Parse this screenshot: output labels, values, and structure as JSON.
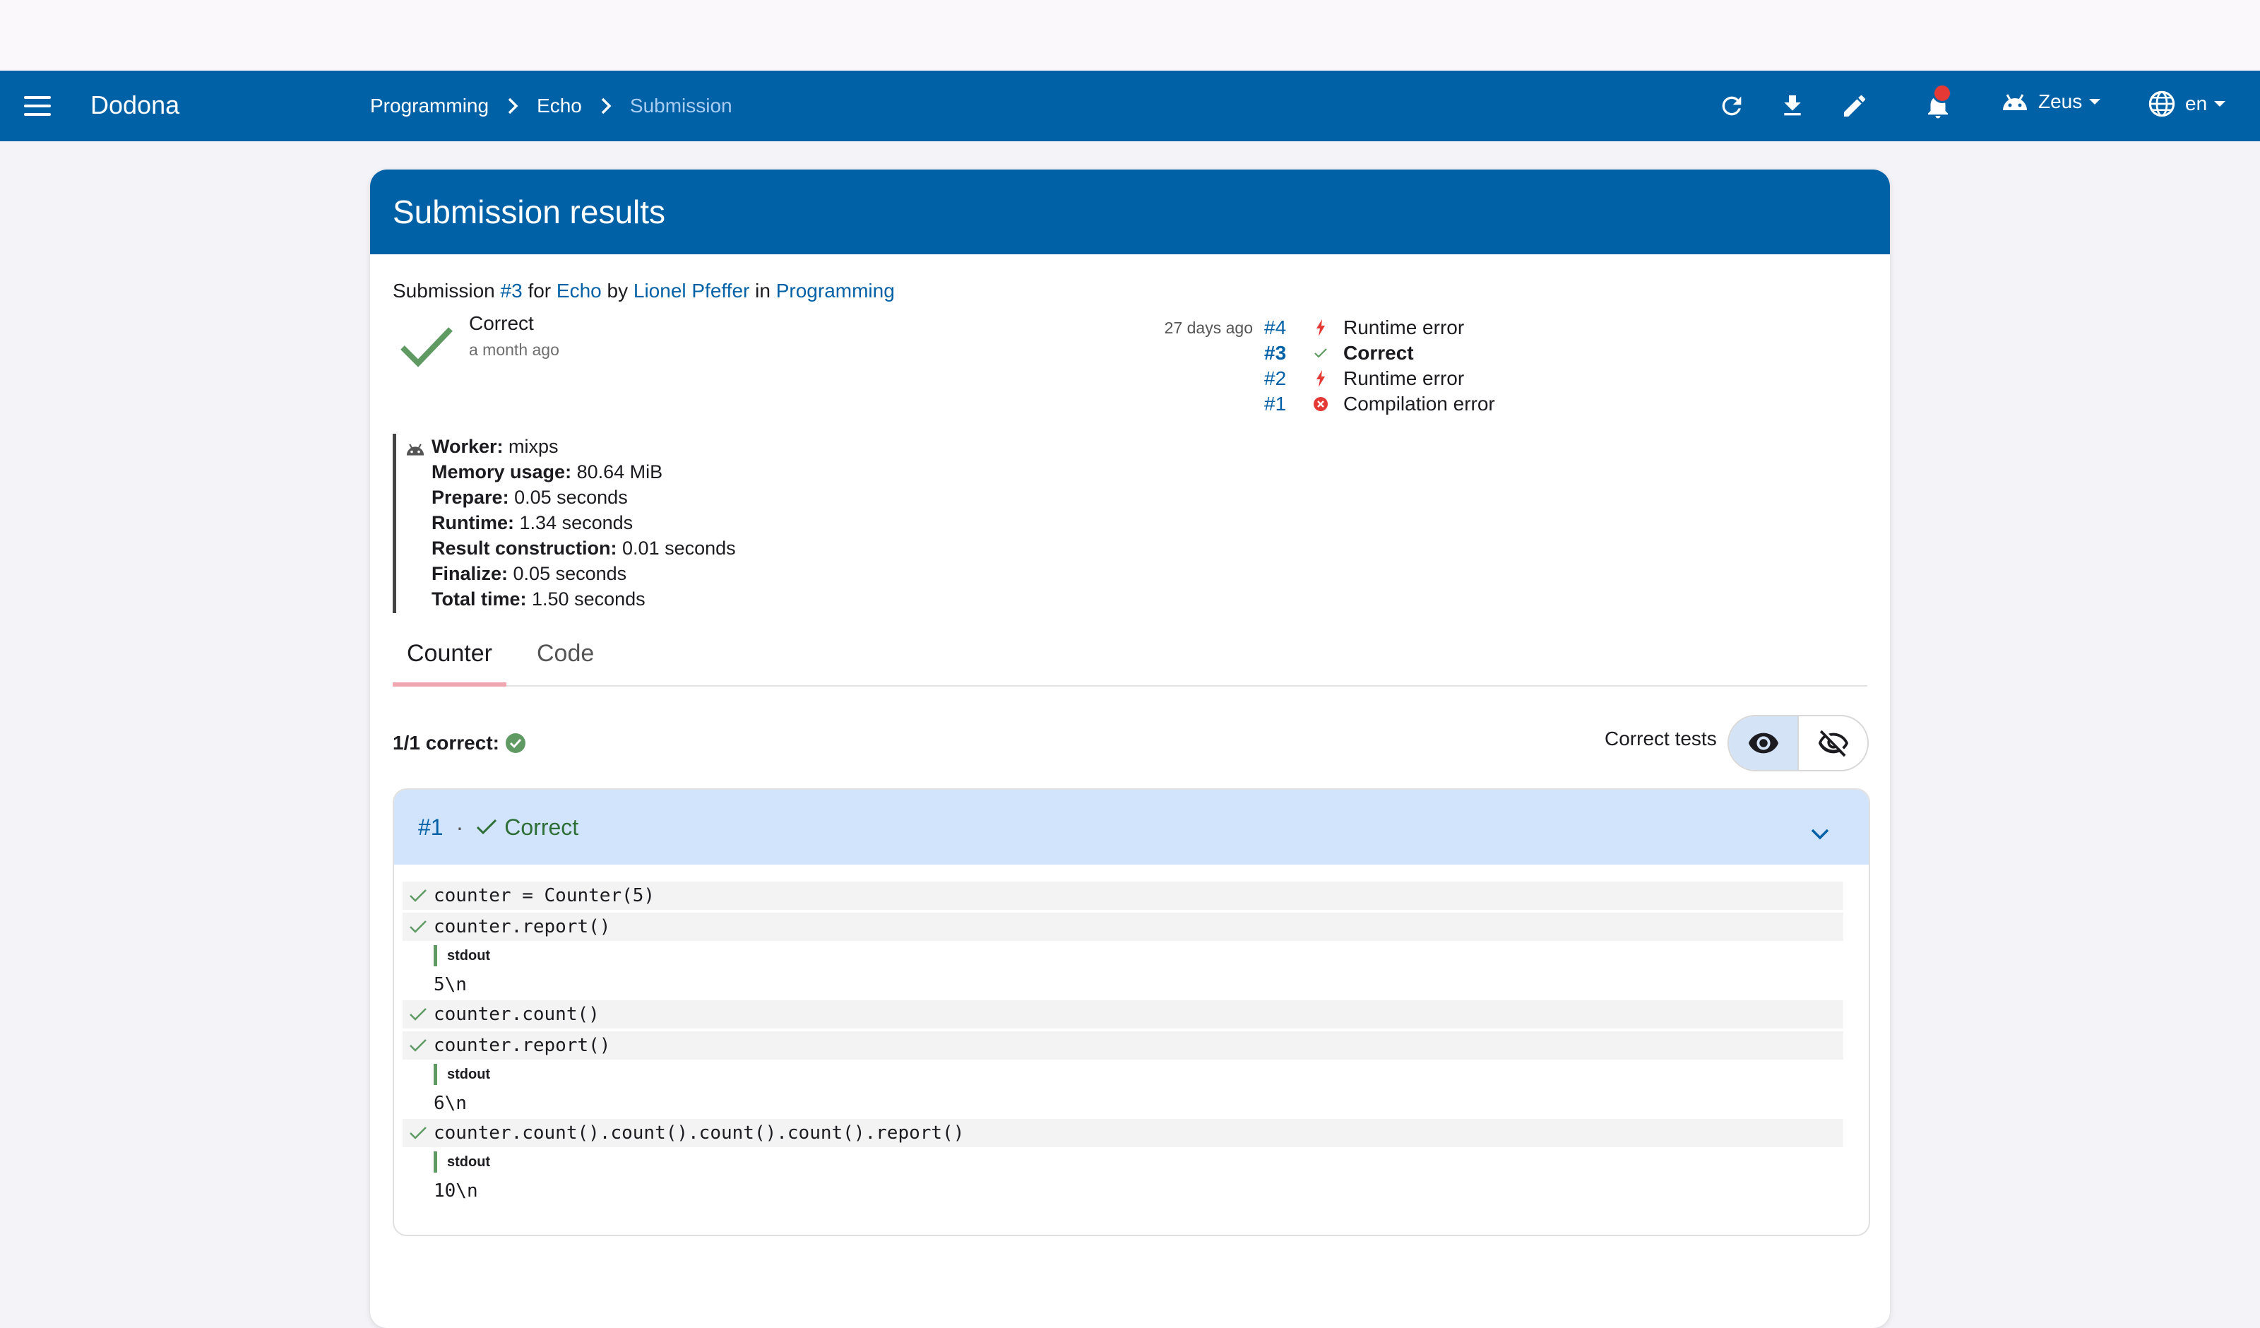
{
  "navbar": {
    "brand": "Dodona",
    "breadcrumbs": [
      "Programming",
      "Echo",
      "Submission"
    ],
    "user": "Zeus",
    "language": "en",
    "notification_dot_color": "#e53935",
    "icons": [
      "refresh-icon",
      "download-icon",
      "edit-icon",
      "bell-icon",
      "android-icon",
      "globe-icon"
    ]
  },
  "card": {
    "title": "Submission results",
    "submission_line": {
      "prefix": "Submission ",
      "number": "#3",
      "for": " for ",
      "exercise": "Echo",
      "by": " by ",
      "user": "Lionel Pfeffer",
      "in": " in ",
      "course": "Programming"
    },
    "status": {
      "title": "Correct",
      "time": "a month ago",
      "color": "#4c8a50"
    },
    "history": [
      {
        "ago": "27 days ago",
        "number": "#4",
        "status": "Runtime error",
        "icon": "bolt-icon",
        "current": false
      },
      {
        "ago": "",
        "number": "#3",
        "status": "Correct",
        "icon": "check-icon",
        "current": true
      },
      {
        "ago": "",
        "number": "#2",
        "status": "Runtime error",
        "icon": "bolt-icon",
        "current": false
      },
      {
        "ago": "",
        "number": "#1",
        "status": "Compilation error",
        "icon": "error-circle-icon",
        "current": false
      }
    ],
    "worker": [
      {
        "label": "Worker:",
        "value": "mixps"
      },
      {
        "label": "Memory usage:",
        "value": "80.64 MiB"
      },
      {
        "label": "Prepare:",
        "value": "0.05 seconds"
      },
      {
        "label": "Runtime:",
        "value": "1.34 seconds"
      },
      {
        "label": "Result construction:",
        "value": "0.01 seconds"
      },
      {
        "label": "Finalize:",
        "value": "0.05 seconds"
      },
      {
        "label": "Total time:",
        "value": "1.50 seconds"
      }
    ],
    "tabs": [
      {
        "label": "Counter",
        "active": true
      },
      {
        "label": "Code",
        "active": false
      }
    ],
    "summary": "1/1 correct:",
    "correct_tests_label": "Correct tests",
    "test": {
      "number": "#1",
      "separator": "·",
      "status": "Correct",
      "stdout_label": "stdout",
      "lines": [
        {
          "code": "counter = Counter(5)",
          "stdout": null
        },
        {
          "code": "counter.report()",
          "stdout": "5\\n"
        },
        {
          "code": "counter.count()",
          "stdout": null
        },
        {
          "code": "counter.report()",
          "stdout": "6\\n"
        },
        {
          "code": "counter.count().count().count().count().report()",
          "stdout": "10\\n"
        }
      ]
    }
  }
}
